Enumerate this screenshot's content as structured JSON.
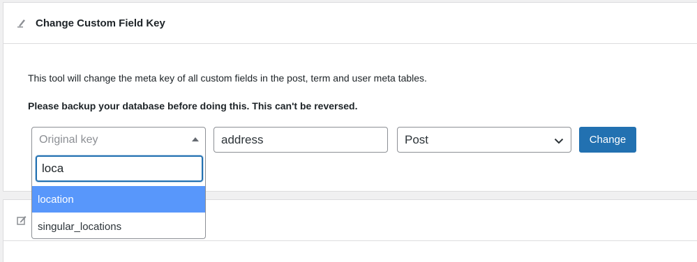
{
  "panel_change_key": {
    "title": "Change Custom Field Key",
    "icon": "pencil-icon",
    "description": "This tool will change the meta key of all custom fields in the post, term and user meta tables.",
    "warning": "Please backup your database before doing this. This can't be reversed.",
    "original_key_select": {
      "placeholder": "Original key",
      "search_value": "loca",
      "options": [
        "location",
        "singular_locations"
      ],
      "highlighted": "location"
    },
    "new_key_input": {
      "value": "address"
    },
    "type_select": {
      "value": "Post"
    },
    "change_button": "Change"
  },
  "panel_second": {
    "icon": "edit-icon"
  },
  "colors": {
    "accent": "#2271b1",
    "highlight": "#5897fb",
    "background": "#f0f0f1",
    "border": "#dcdcde"
  }
}
